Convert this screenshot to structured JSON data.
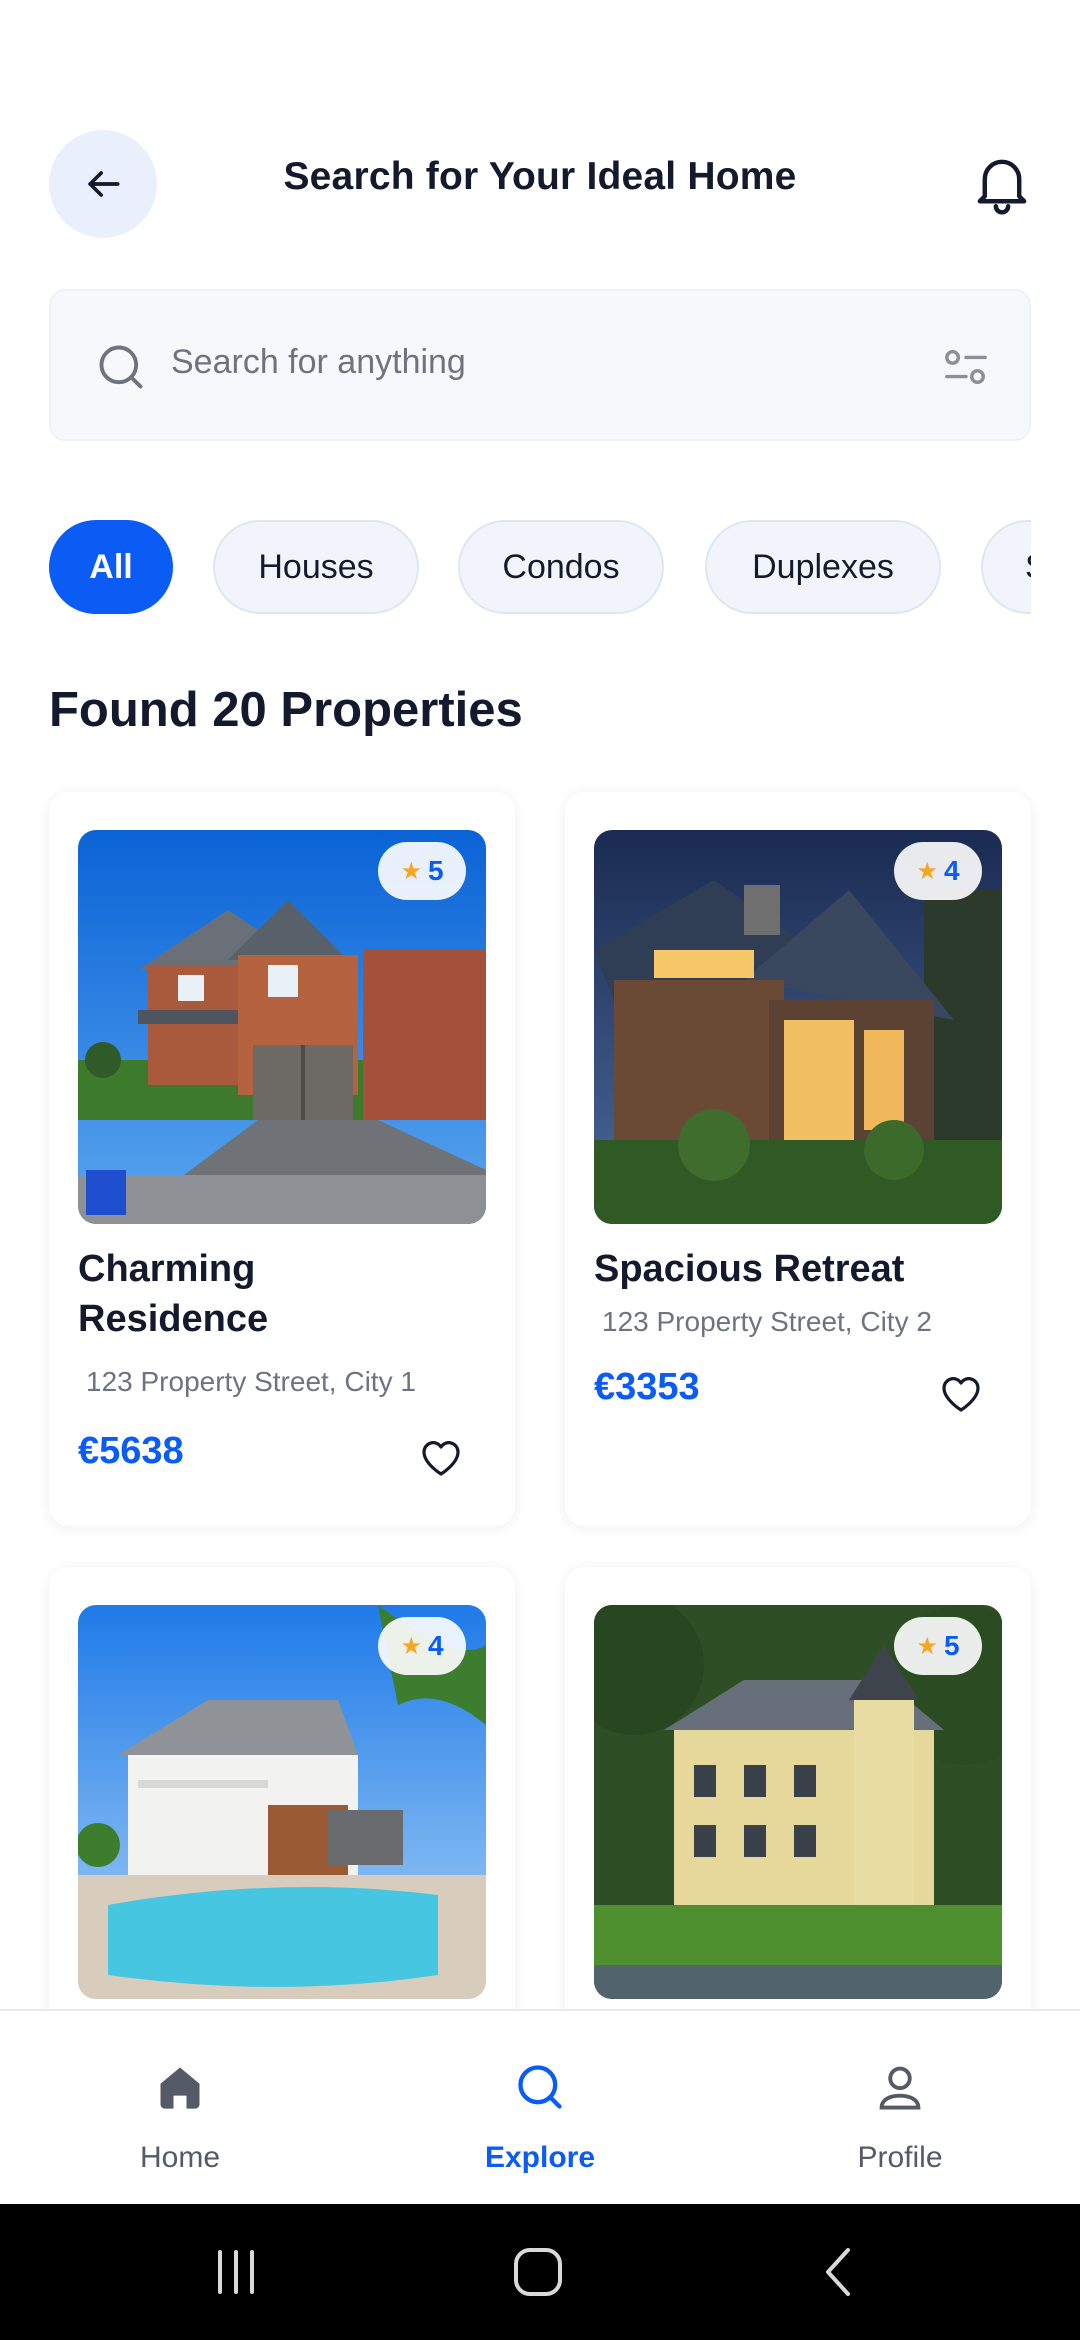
{
  "header": {
    "title": "Search for Your Ideal Home",
    "back_icon": "arrow-left-icon",
    "notification_icon": "bell-icon"
  },
  "search": {
    "placeholder": "Search for anything",
    "search_icon": "search-icon",
    "filter_icon": "sliders-icon"
  },
  "chips": [
    {
      "label": "All",
      "active": true
    },
    {
      "label": "Houses",
      "active": false
    },
    {
      "label": "Condos",
      "active": false
    },
    {
      "label": "Duplexes",
      "active": false
    },
    {
      "label": "S",
      "active": false
    }
  ],
  "results": {
    "title": "Found 20 Properties"
  },
  "properties": [
    {
      "name_line1": "Charming",
      "name_line2": "Residence",
      "address": "123 Property Street, City 1",
      "price": "€5638",
      "rating": "5"
    },
    {
      "name_line1": "Spacious Retreat",
      "address": "123 Property Street, City 2",
      "price": "€3353",
      "rating": "4"
    },
    {
      "rating": "4"
    },
    {
      "rating": "5"
    }
  ],
  "bottom_nav": [
    {
      "label": "Home",
      "icon": "home-icon",
      "active": false
    },
    {
      "label": "Explore",
      "icon": "search-icon",
      "active": true
    },
    {
      "label": "Profile",
      "icon": "user-icon",
      "active": false
    }
  ],
  "colors": {
    "accent": "#0a5cf5",
    "text": "#141a2e",
    "muted": "#6f7380",
    "star": "#f5a623"
  }
}
